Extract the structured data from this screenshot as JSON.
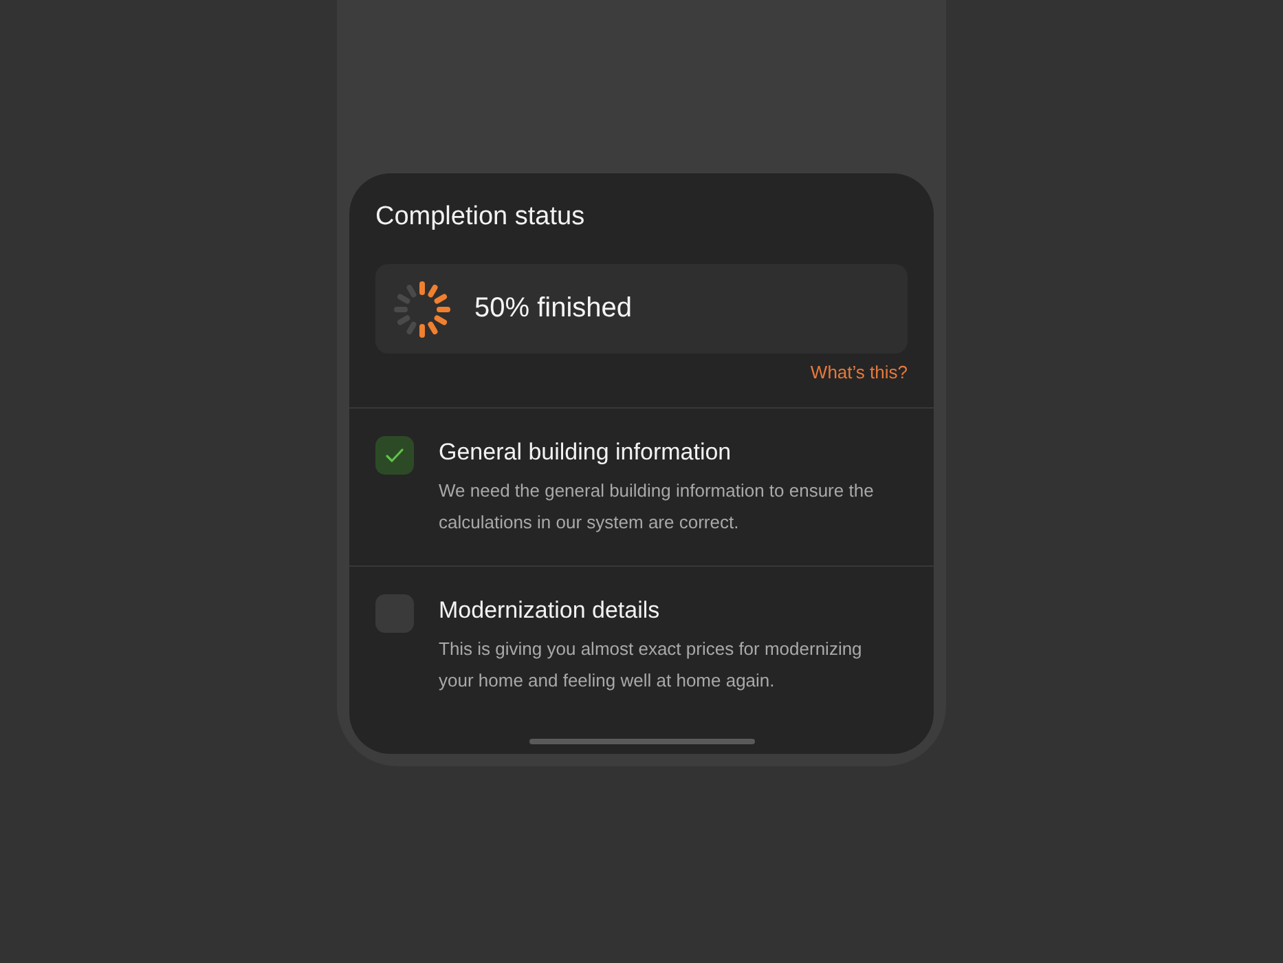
{
  "sheet": {
    "title": "Completion status",
    "progress": {
      "label": "50% finished"
    },
    "help_link": "What’s this?"
  },
  "tasks": [
    {
      "title": "General building information",
      "description": "We need the general building information to ensure the calculations in our system are correct.",
      "checked": true
    },
    {
      "title": "Modernization details",
      "description": "This is giving you almost exact prices for modernizing your home and feeling well at home again.",
      "checked": false
    }
  ]
}
